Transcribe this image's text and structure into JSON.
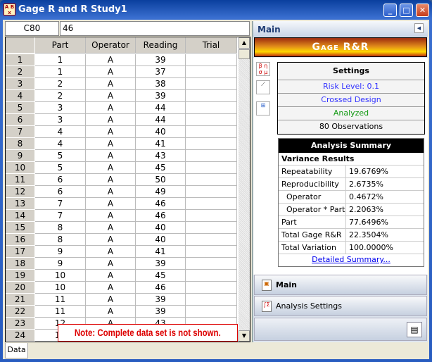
{
  "window": {
    "title": "Gage R and R Study1",
    "minimize": "_",
    "maximize": "□",
    "close": "✕"
  },
  "formula_bar": {
    "cell_ref": "C80",
    "value": "46"
  },
  "grid": {
    "columns": [
      "",
      "Part",
      "Operator",
      "Reading",
      "Trial"
    ],
    "rows": [
      [
        "1",
        "1",
        "A",
        "39",
        ""
      ],
      [
        "2",
        "1",
        "A",
        "37",
        ""
      ],
      [
        "3",
        "2",
        "A",
        "38",
        ""
      ],
      [
        "4",
        "2",
        "A",
        "39",
        ""
      ],
      [
        "5",
        "3",
        "A",
        "44",
        ""
      ],
      [
        "6",
        "3",
        "A",
        "44",
        ""
      ],
      [
        "7",
        "4",
        "A",
        "40",
        ""
      ],
      [
        "8",
        "4",
        "A",
        "41",
        ""
      ],
      [
        "9",
        "5",
        "A",
        "43",
        ""
      ],
      [
        "10",
        "5",
        "A",
        "45",
        ""
      ],
      [
        "11",
        "6",
        "A",
        "50",
        ""
      ],
      [
        "12",
        "6",
        "A",
        "49",
        ""
      ],
      [
        "13",
        "7",
        "A",
        "46",
        ""
      ],
      [
        "14",
        "7",
        "A",
        "46",
        ""
      ],
      [
        "15",
        "8",
        "A",
        "40",
        ""
      ],
      [
        "16",
        "8",
        "A",
        "40",
        ""
      ],
      [
        "17",
        "9",
        "A",
        "41",
        ""
      ],
      [
        "18",
        "9",
        "A",
        "39",
        ""
      ],
      [
        "19",
        "10",
        "A",
        "45",
        ""
      ],
      [
        "20",
        "10",
        "A",
        "46",
        ""
      ],
      [
        "21",
        "11",
        "A",
        "39",
        ""
      ],
      [
        "22",
        "11",
        "A",
        "39",
        ""
      ],
      [
        "23",
        "12",
        "A",
        "43",
        ""
      ],
      [
        "24",
        "12",
        "",
        "",
        " "
      ]
    ],
    "note": "Note: Complete data set is not shown."
  },
  "right_panel": {
    "header": "Main",
    "banner": "Gage R&R",
    "icons": [
      "parameters-icon",
      "plot-icon",
      "analysis-icon"
    ],
    "settings": {
      "title": "Settings",
      "risk_level": "Risk Level: 0.1",
      "design": "Crossed Design",
      "status": "Analyzed",
      "observations": "80 Observations"
    },
    "colors": {
      "link": "#3333ff",
      "status": "#119911"
    },
    "summary": {
      "title": "Analysis Summary",
      "section": "Variance Results",
      "rows": [
        {
          "label": "Repeatability",
          "value": "19.6769%"
        },
        {
          "label": "Reproducibility",
          "value": "2.6735%"
        },
        {
          "label": "Operator",
          "value": "0.4672%"
        },
        {
          "label": "Operator * Part",
          "value": "2.2063%"
        },
        {
          "label": "Part",
          "value": "77.6496%"
        },
        {
          "label": "Total Gage R&R",
          "value": "22.3504%"
        },
        {
          "label": "Total Variation",
          "value": "100.0000%"
        }
      ],
      "link": "Detailed Summary..."
    },
    "nav": [
      {
        "label": "Main"
      },
      {
        "label": "Analysis Settings"
      }
    ]
  },
  "tabs": [
    {
      "label": "Data"
    }
  ]
}
